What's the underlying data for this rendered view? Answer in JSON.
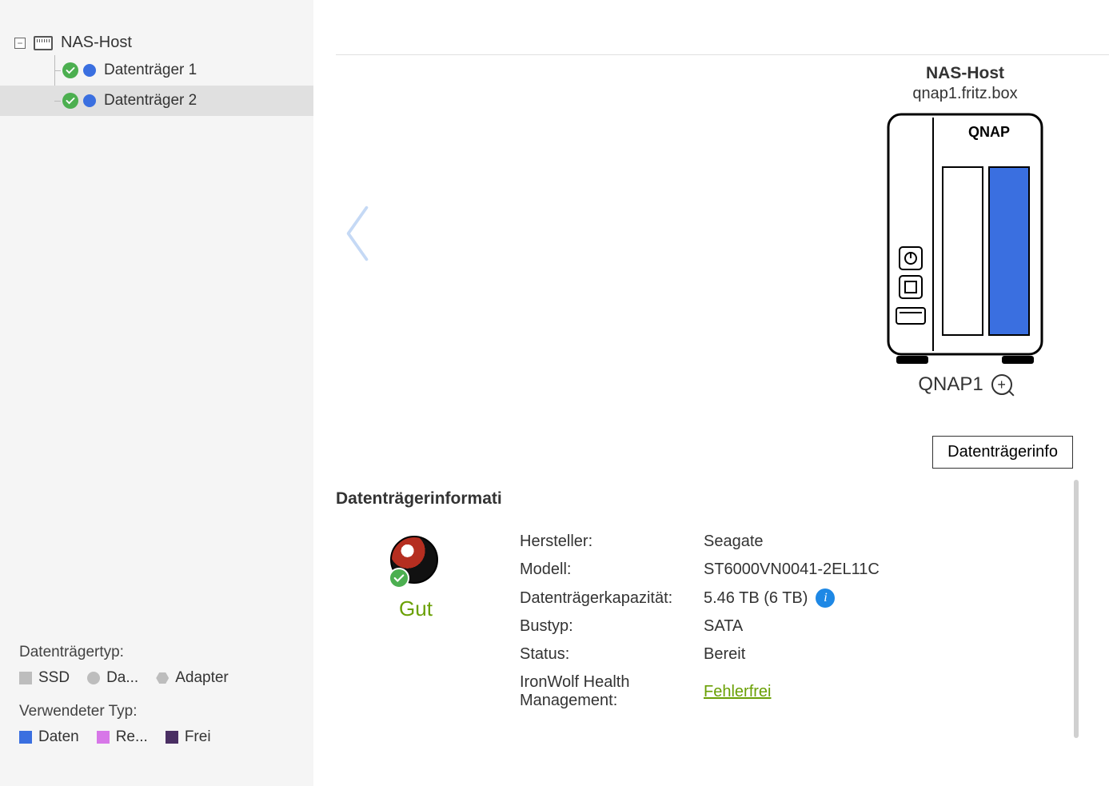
{
  "tree": {
    "root_label": "NAS-Host",
    "items": [
      {
        "label": "Datenträger 1",
        "selected": false
      },
      {
        "label": "Datenträger 2",
        "selected": true
      }
    ]
  },
  "legend": {
    "type_title": "Datenträgertyp:",
    "type_items": [
      {
        "label": "SSD",
        "shape": "square",
        "color": "#bdbdbd"
      },
      {
        "label": "Da...",
        "shape": "circle",
        "color": "#bdbdbd"
      },
      {
        "label": "Adapter",
        "shape": "hex",
        "color": "#bdbdbd"
      }
    ],
    "used_title": "Verwendeter Typ:",
    "used_items": [
      {
        "label": "Daten",
        "shape": "square",
        "color": "#3a6fe0"
      },
      {
        "label": "Re...",
        "shape": "square",
        "color": "#d777e8"
      },
      {
        "label": "Frei",
        "shape": "square",
        "color": "#4a2f63"
      }
    ]
  },
  "device": {
    "title": "NAS-Host",
    "host": "qnap1.fritz.box",
    "brand": "QNAP",
    "name": "QNAP1"
  },
  "buttons": {
    "disk_info": "Datenträgerinfo"
  },
  "info": {
    "heading": "Datenträgerinformati",
    "status_text": "Gut",
    "rows": {
      "r0": {
        "k": "Hersteller:",
        "v": "Seagate"
      },
      "r1": {
        "k": "Modell:",
        "v": "ST6000VN0041-2EL11C"
      },
      "r2": {
        "k": "Datenträgerkapazität:",
        "v": "5.46 TB (6 TB)"
      },
      "r3": {
        "k": "Bustyp:",
        "v": "SATA"
      },
      "r4": {
        "k": "Status:",
        "v": "Bereit"
      },
      "r5": {
        "k": "IronWolf Health Management:",
        "v": "Fehlerfrei"
      }
    }
  }
}
